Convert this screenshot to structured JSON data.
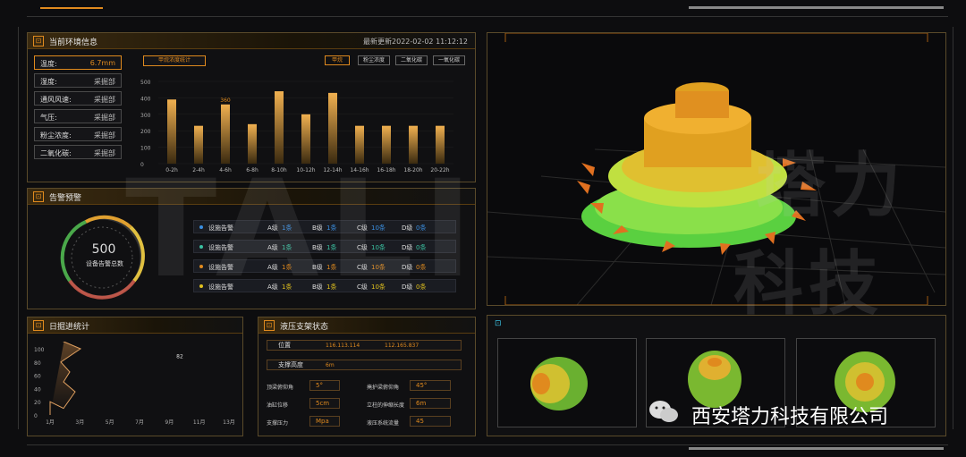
{
  "env": {
    "title": "当前环境信息",
    "updated": "最新更新2022-02-02  11:12:12",
    "tab": "甲烷浓度统计",
    "buttons": [
      "甲烷",
      "粉尘浓度",
      "二氧化碳",
      "一氧化碳"
    ],
    "metrics": [
      {
        "label": "温度:",
        "value": "6.7mm"
      },
      {
        "label": "湿度:",
        "value": "采掘部"
      },
      {
        "label": "通风风速:",
        "value": "采掘部"
      },
      {
        "label": "气压:",
        "value": "采掘部"
      },
      {
        "label": "粉尘浓度:",
        "value": "采掘部"
      },
      {
        "label": "二氧化碳:",
        "value": "采掘部"
      }
    ]
  },
  "chart_data": [
    {
      "type": "bar",
      "categories": [
        "0-2h",
        "2-4h",
        "4-6h",
        "6-8h",
        "8-10h",
        "10-12h",
        "12-14h",
        "14-16h",
        "16-18h",
        "18-20h",
        "20-22h"
      ],
      "values": [
        390,
        230,
        360,
        240,
        440,
        300,
        430,
        230,
        230,
        230,
        230
      ],
      "yticks": [
        "500",
        "400",
        "300",
        "200",
        "100",
        "0"
      ],
      "ylim": [
        0,
        500
      ],
      "annotation": "360"
    },
    {
      "type": "area",
      "categories": [
        "1月",
        "3月",
        "5月",
        "7月",
        "9月",
        "11月",
        "13月"
      ],
      "yticks": [
        "100",
        "80",
        "60",
        "40",
        "20",
        "0"
      ],
      "ylim": [
        0,
        100
      ],
      "peak_label": "82"
    }
  ],
  "alarm": {
    "title": "告警预警",
    "count": "500",
    "count_label": "设备告警总数",
    "rows": [
      {
        "name": "设施告警",
        "a": "1条",
        "b": "1条",
        "c": "10条",
        "d": "0条",
        "color": "#3a8ee0"
      },
      {
        "name": "设施告警",
        "a": "1条",
        "b": "1条",
        "c": "10条",
        "d": "0条",
        "color": "#3ac0a0"
      },
      {
        "name": "设施告警",
        "a": "1条",
        "b": "1条",
        "c": "10条",
        "d": "0条",
        "color": "#e08a1e"
      },
      {
        "name": "设施告警",
        "a": "1条",
        "b": "1条",
        "c": "10条",
        "d": "0条",
        "color": "#e0c01e"
      }
    ],
    "levels": [
      "A级",
      "B级",
      "C级",
      "D级"
    ]
  },
  "daily": {
    "title": "日掘进统计"
  },
  "hyd": {
    "title": "液压支架状态",
    "pos_label": "位置",
    "pos1": "116.113.114",
    "pos2": "112.165.837",
    "h_label": "支撑高度",
    "h_value": "6m",
    "params": [
      {
        "l": "顶梁俯仰角",
        "v": "5°"
      },
      {
        "l": "掩护梁俯仰角",
        "v": "45°"
      },
      {
        "l": "油缸位移",
        "v": "5cm"
      },
      {
        "l": "立柱的伸缩长度",
        "v": "6m"
      },
      {
        "l": "支撑压力",
        "v": "Mpa"
      },
      {
        "l": "液压系统流量",
        "v": "45"
      }
    ]
  },
  "brand": {
    "wm1": "塔力",
    "wm2": "科技",
    "company": "西安塔力科技有限公司",
    "logo": "TALI"
  },
  "colors": {
    "accent": "#e08a1e",
    "panel_border": "#5a4a2a"
  }
}
